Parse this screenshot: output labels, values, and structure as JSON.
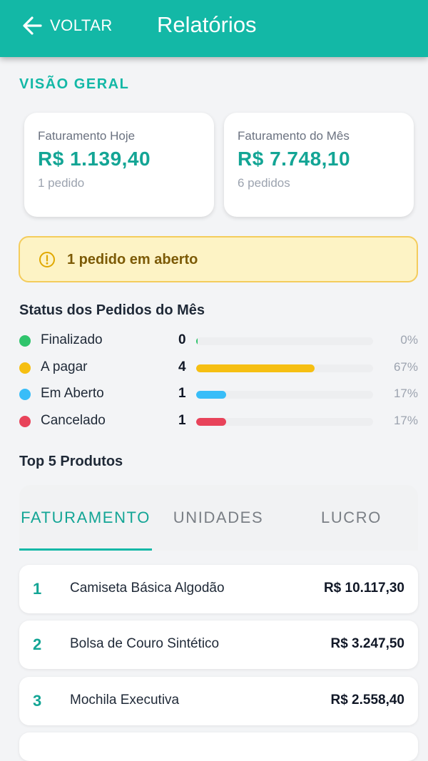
{
  "header": {
    "back_label": "VOLTAR",
    "title": "Relatórios",
    "color": "#13b8a6"
  },
  "overview": {
    "section_label": "VISÃO GERAL",
    "cards": [
      {
        "label": "Faturamento Hoje",
        "value": "R$ 1.139,40",
        "sub": "1 pedido"
      },
      {
        "label": "Faturamento do Mês",
        "value": "R$ 7.748,10",
        "sub": "6 pedidos"
      }
    ]
  },
  "alert": {
    "icon": "warning-circle-icon",
    "text": "1 pedido em aberto"
  },
  "status": {
    "title": "Status dos Pedidos do Mês",
    "items": [
      {
        "name": "Finalizado",
        "count": "0",
        "percent": "0%",
        "fraction": 0.0,
        "color": "#2fc46c"
      },
      {
        "name": "A pagar",
        "count": "4",
        "percent": "67%",
        "fraction": 0.67,
        "color": "#f6bf12"
      },
      {
        "name": "Em Aberto",
        "count": "1",
        "percent": "17%",
        "fraction": 0.17,
        "color": "#38bdf8"
      },
      {
        "name": "Cancelado",
        "count": "1",
        "percent": "17%",
        "fraction": 0.17,
        "color": "#e8435a"
      }
    ]
  },
  "top_products": {
    "title": "Top 5 Produtos",
    "tabs": [
      {
        "label": "FATURAMENTO",
        "active": true
      },
      {
        "label": "UNIDADES",
        "active": false
      },
      {
        "label": "LUCRO",
        "active": false
      }
    ],
    "items": [
      {
        "rank": "1",
        "name": "Camiseta Básica Algodão",
        "value": "R$ 10.117,30"
      },
      {
        "rank": "2",
        "name": "Bolsa de Couro Sintético",
        "value": "R$ 3.247,50"
      },
      {
        "rank": "3",
        "name": "Mochila Executiva",
        "value": "R$ 2.558,40"
      }
    ]
  }
}
